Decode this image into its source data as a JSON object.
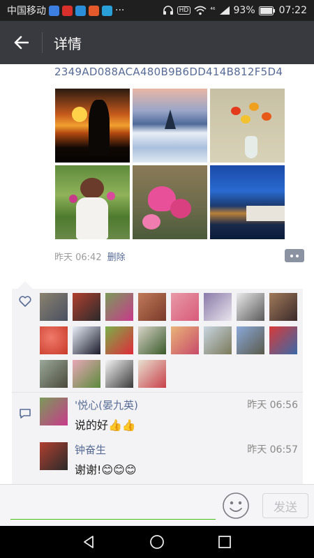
{
  "status_bar": {
    "carrier": "中国移动",
    "dots": "···",
    "hd_badge": "HD",
    "signal_type": "⁴⁶",
    "battery": "93%",
    "time": "07:22"
  },
  "title_bar": {
    "title": "详情"
  },
  "post": {
    "text": "2349AD088ACA480B9B6DD414B812F5D4",
    "time": "昨天 06:42",
    "delete_label": "删除"
  },
  "comments": [
    {
      "author": "'悦心(晏九英)",
      "time": "昨天 06:56",
      "text": "说的好👍👍"
    },
    {
      "author": "钟奋生",
      "time": "昨天 06:57",
      "text": "谢谢!😊😊😊"
    }
  ],
  "input": {
    "placeholder": "",
    "send_label": "发送"
  },
  "colors": {
    "link": "#576b95",
    "title_bar": "#393a3f",
    "status_bar": "#1f1f1f",
    "accent_green": "#45c01a",
    "panel": "#f3f3f5"
  },
  "icons": [
    "back-arrow-icon",
    "heart-icon",
    "comment-icon",
    "more-icon",
    "emoji-icon",
    "nav-back-icon",
    "nav-home-icon",
    "nav-recents-icon"
  ]
}
